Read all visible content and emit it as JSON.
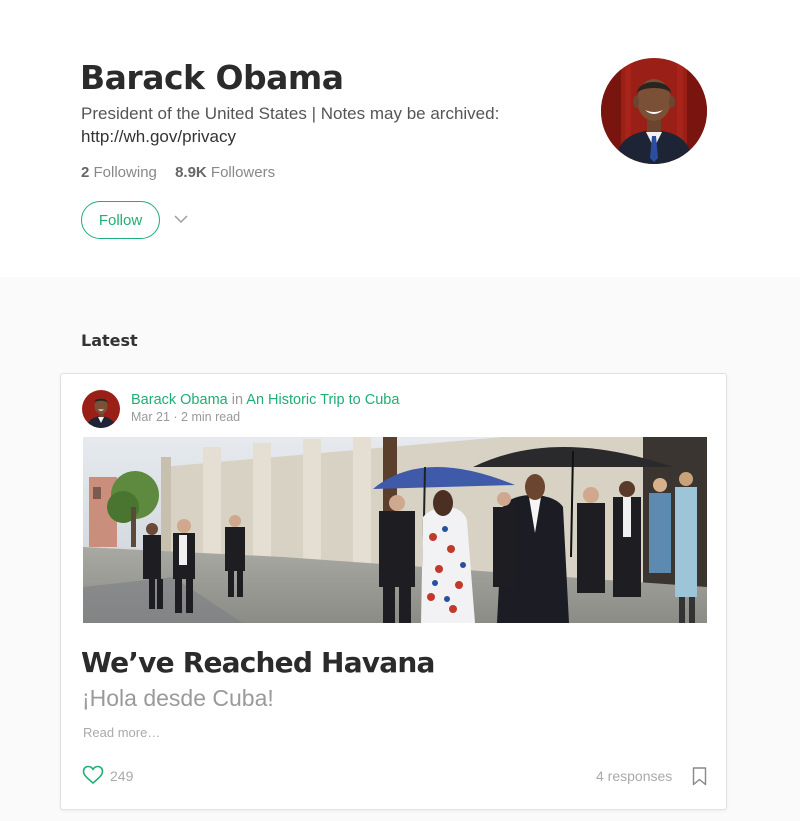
{
  "profile": {
    "name": "Barack Obama",
    "bio": "President of the United States | Notes may be archived:",
    "bio_url": "http://wh.gov/privacy",
    "following_count": "2",
    "following_label": "Following",
    "followers_count": "8.9K",
    "followers_label": "Followers",
    "follow_label": "Follow"
  },
  "section": {
    "latest_label": "Latest"
  },
  "post": {
    "author": "Barack Obama",
    "in_word": "in",
    "publication": "An Historic Trip to Cuba",
    "date": "Mar 21",
    "separator": "·",
    "read_time": "2 min read",
    "title": "We’ve Reached Havana",
    "subtitle": "¡Hola desde Cuba!",
    "read_more": "Read more…",
    "likes": "249",
    "responses": "4 responses"
  },
  "icons": {
    "dropdown": "chevron-down-icon",
    "like": "heart-icon",
    "bookmark": "bookmark-icon"
  },
  "colors": {
    "accent": "#1fae74",
    "muted_text": "#999999",
    "page_background": "#fafafa"
  }
}
